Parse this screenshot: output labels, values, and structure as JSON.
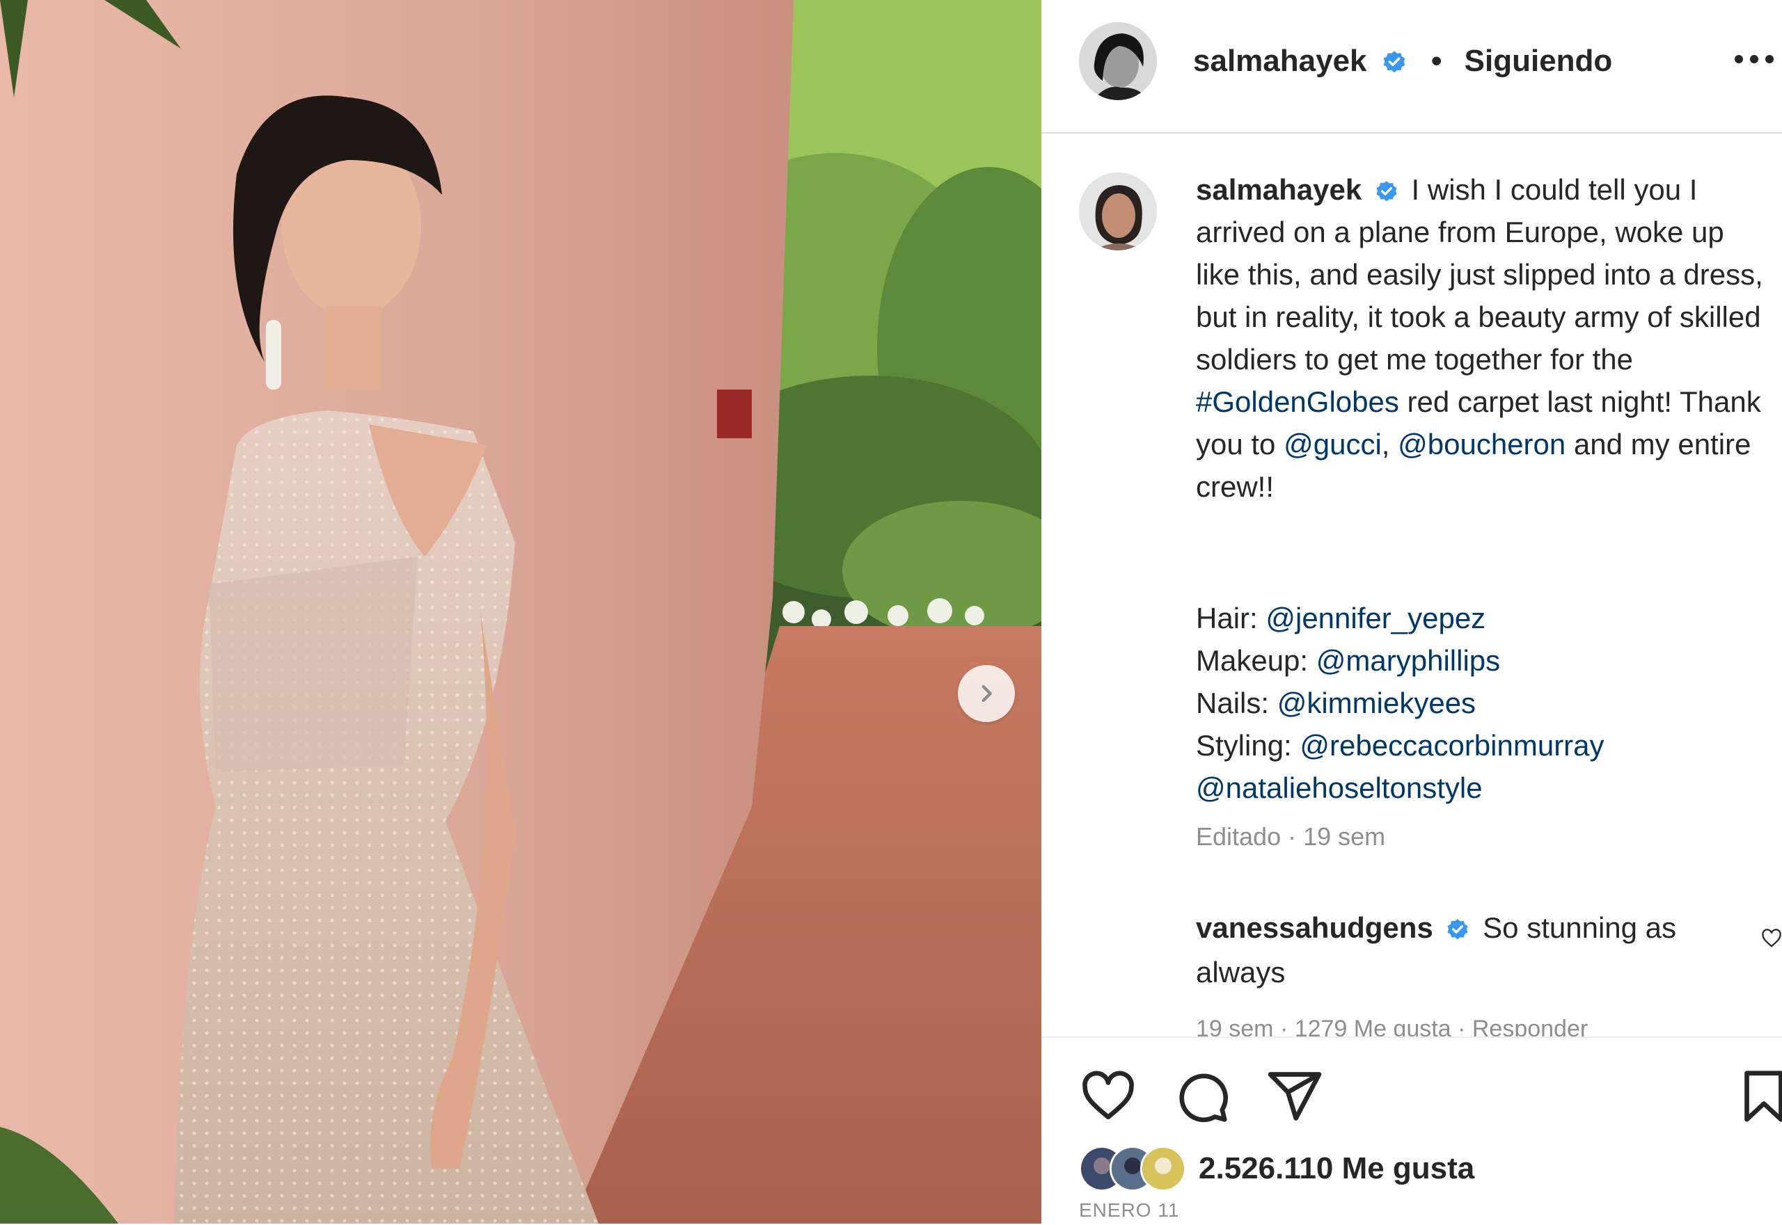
{
  "photo": {
    "alt_icon": "chevron-right-icon"
  },
  "header": {
    "username": "salmahayek",
    "separator": "•",
    "follow_status": "Siguiendo",
    "more_icon": "more-horizontal-icon"
  },
  "caption": {
    "username": "salmahayek",
    "text_1": "I wish I could tell you I arrived on a plane from Europe, woke up like this, and easily just slipped into a dress, but in reality, it took a beauty army of skilled soldiers to get me together for the ",
    "hashtag": "#GoldenGlobes",
    "text_2": " red carpet last night! Thank you to ",
    "mention_1": "@gucci",
    "text_3": ", ",
    "mention_2": "@boucheron",
    "text_4": " and my entire crew!!",
    "credits": [
      {
        "label": "Hair: ",
        "handle": "@jennifer_yepez"
      },
      {
        "label": "Makeup: ",
        "handle": "@maryphillips"
      },
      {
        "label": "Nails: ",
        "handle": "@kimmiekyees"
      },
      {
        "label": "Styling: ",
        "handle": "@rebeccacorbinmurray"
      },
      {
        "label": "",
        "handle": "@natalieh​oseltonstyle"
      }
    ],
    "meta": "Editado · 19 sem"
  },
  "comment": {
    "username": "vanessahudgens",
    "text": "So stunning as always",
    "meta": "19 sem · 1279 Me gusta · Responder"
  },
  "actions": {
    "like_icon": "heart-icon",
    "comment_icon": "comment-icon",
    "share_icon": "send-icon",
    "save_icon": "bookmark-icon",
    "likes_count": "2.526.110",
    "likes_label": "Me gusta",
    "date": "ENERO 11"
  },
  "colors": {
    "verified": "#3897f0",
    "link": "#00376b",
    "muted": "#8e8e8e",
    "divider": "#dbdbdb"
  }
}
